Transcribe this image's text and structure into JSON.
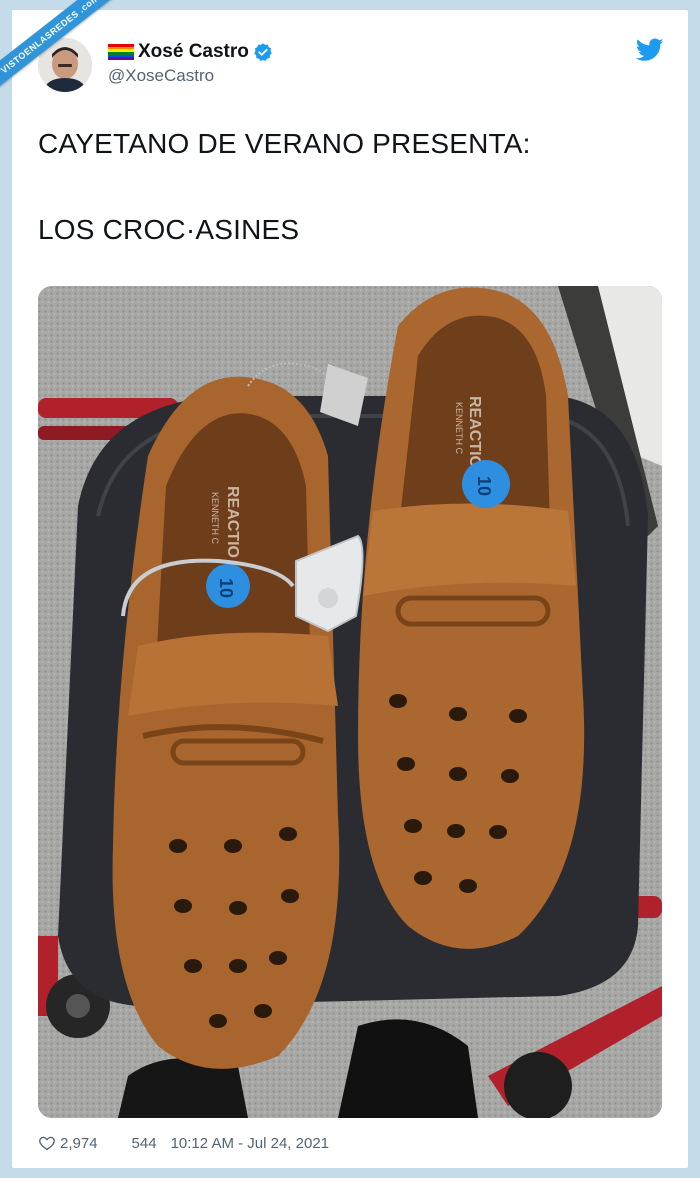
{
  "watermark": {
    "text": "VISTOENLASREDES .com"
  },
  "tweet": {
    "author_name": "Xosé Castro",
    "author_handle": "@XoseCastro",
    "text_line_1": "CAYETANO DE VERANO PRESENTA:",
    "text_line_2": "LOS CROC·ASINES",
    "likes": "2,974",
    "retweets": "544",
    "timestamp": "10:12 AM - Jul 24, 2021"
  },
  "photo": {
    "brand_print_left": [
      "REACTIO",
      "KENNETH C"
    ],
    "brand_print_right": [
      "REACTIO",
      "KENNETH C"
    ],
    "size_sticker_left": "10",
    "size_sticker_right": "10"
  },
  "colors": {
    "background": "#c4dcea",
    "twitter_blue": "#1d9bf0",
    "shoe_brown": "#a8652d",
    "seat_black": "#2a2c31",
    "frame_red": "#b0212c"
  },
  "icons": [
    "heart-icon",
    "retweet-icon",
    "verified-badge-icon",
    "twitter-bird-icon",
    "rainbow-flag-icon"
  ]
}
